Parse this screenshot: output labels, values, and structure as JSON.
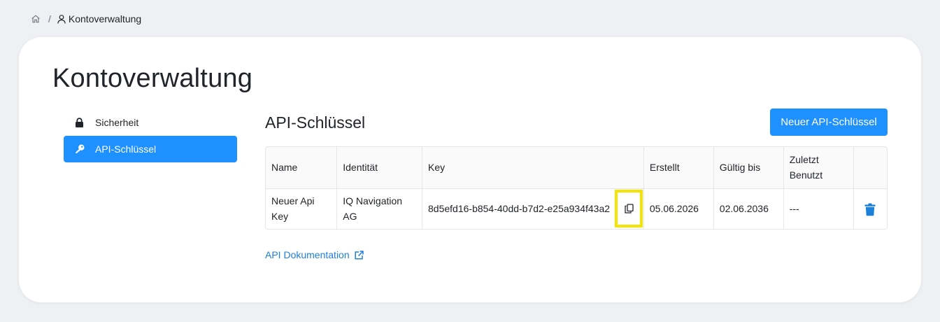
{
  "breadcrumb": {
    "separator": "/",
    "current": "Kontoverwaltung"
  },
  "page": {
    "title": "Kontoverwaltung"
  },
  "sidebar": {
    "items": [
      {
        "label": "Sicherheit",
        "icon": "lock-icon",
        "active": false
      },
      {
        "label": "API-Schlüssel",
        "icon": "key-icon",
        "active": true
      }
    ]
  },
  "api_keys": {
    "title": "API-Schlüssel",
    "new_button_label": "Neuer API-Schlüssel",
    "columns": [
      "Name",
      "Identität",
      "Key",
      "Erstellt",
      "Gültig bis",
      "Zuletzt Benutzt"
    ],
    "rows": [
      {
        "name": "Neuer Api Key",
        "identity": "IQ Navigation AG",
        "key": "8d5efd16-b854-40dd-b7d2-e25a934f43a2",
        "created": "05.06.2026",
        "valid_until": "02.06.2036",
        "last_used": "---"
      }
    ],
    "doc_link_label": "API Dokumentation"
  },
  "colors": {
    "accent": "#1e90ff",
    "highlight": "#f5e400",
    "link": "#1e7fd8"
  }
}
